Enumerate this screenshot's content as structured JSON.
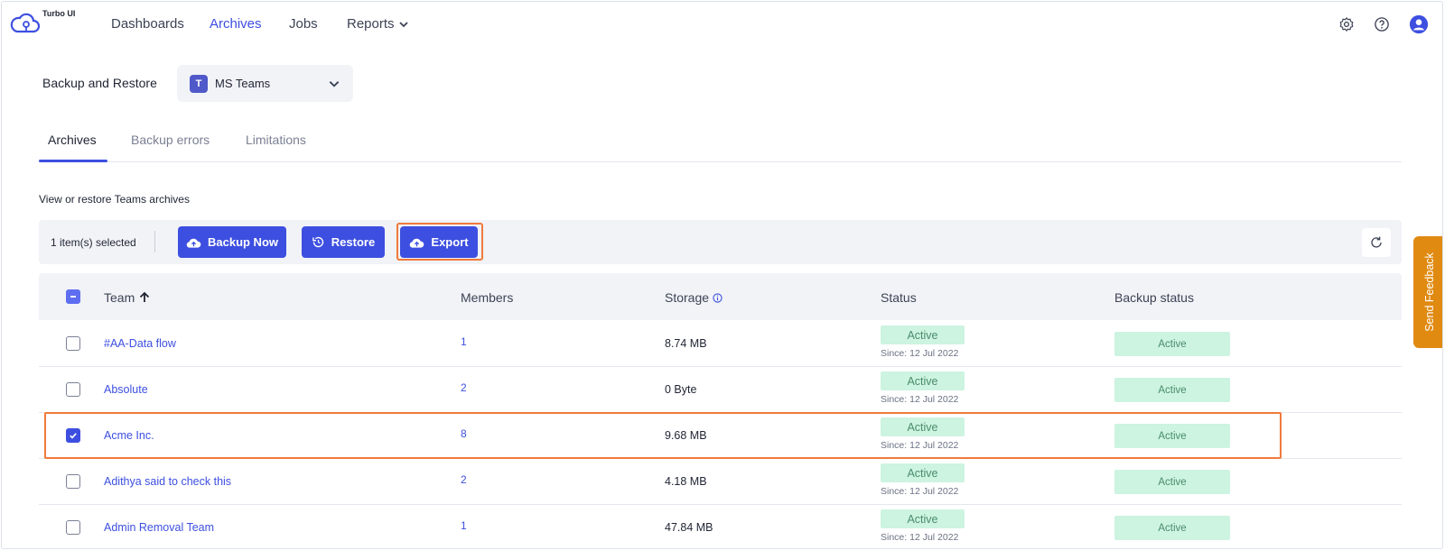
{
  "app": {
    "name": "Turbo UI",
    "accent": "#3d4fe0"
  },
  "nav": {
    "items": [
      {
        "label": "Dashboards",
        "active": false
      },
      {
        "label": "Archives",
        "active": true
      },
      {
        "label": "Jobs",
        "active": false
      },
      {
        "label": "Reports",
        "active": false,
        "has_dropdown": true
      }
    ],
    "icons": [
      "gear-icon",
      "help-icon",
      "user-icon"
    ]
  },
  "page": {
    "section_label": "Backup and Restore",
    "product_select": {
      "value": "MS Teams",
      "icon": "ms-teams-icon"
    },
    "tabs": [
      {
        "label": "Archives",
        "active": true
      },
      {
        "label": "Backup errors",
        "active": false
      },
      {
        "label": "Limitations",
        "active": false
      }
    ],
    "description": "View or restore Teams archives"
  },
  "toolbar": {
    "selected_count": "1 item(s) selected",
    "backup_now": "Backup Now",
    "restore": "Restore",
    "export": "Export",
    "refresh_icon": "refresh-icon"
  },
  "table": {
    "columns": [
      "Team",
      "Members",
      "Storage",
      "Status",
      "Backup status"
    ],
    "sort": {
      "column": "Team",
      "direction": "asc"
    },
    "rows": [
      {
        "team": "#AA-Data flow",
        "members": "1",
        "storage": "8.74 MB",
        "status": "Active",
        "since": "Since: 12 Jul 2022",
        "backup_status": "Active",
        "checked": false
      },
      {
        "team": "Absolute",
        "members": "2",
        "storage": "0 Byte",
        "status": "Active",
        "since": "Since: 12 Jul 2022",
        "backup_status": "Active",
        "checked": false
      },
      {
        "team": "Acme Inc.",
        "members": "8",
        "storage": "9.68 MB",
        "status": "Active",
        "since": "Since: 12 Jul 2022",
        "backup_status": "Active",
        "checked": true
      },
      {
        "team": "Adithya said to check this",
        "members": "2",
        "storage": "4.18 MB",
        "status": "Active",
        "since": "Since: 12 Jul 2022",
        "backup_status": "Active",
        "checked": false
      },
      {
        "team": "Admin Removal Team",
        "members": "1",
        "storage": "47.84 MB",
        "status": "Active",
        "since": "Since: 12 Jul 2022",
        "backup_status": "Active",
        "checked": false
      }
    ]
  },
  "feedback": {
    "label": "Send Feedback",
    "color": "#e08a12"
  }
}
